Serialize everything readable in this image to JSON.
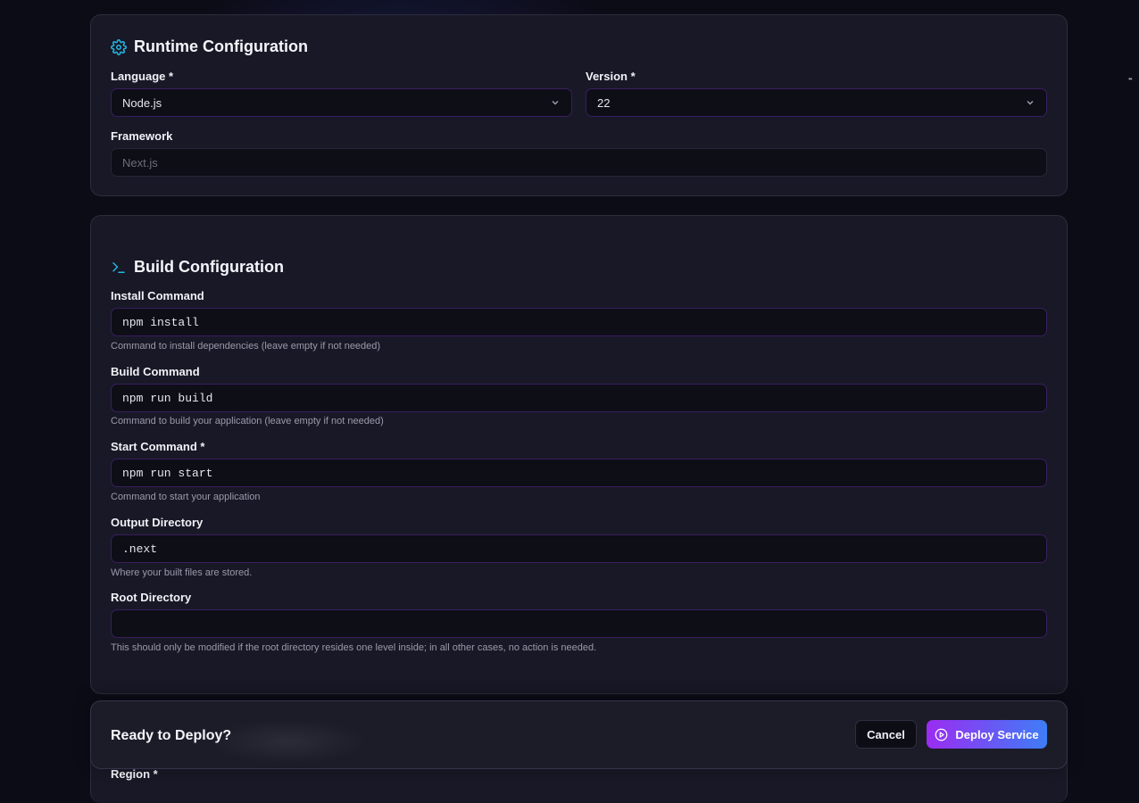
{
  "runtime": {
    "title": "Runtime Configuration",
    "icon": "gear-icon",
    "language_label": "Language *",
    "language_value": "Node.js",
    "version_label": "Version *",
    "version_value": "22",
    "framework_label": "Framework",
    "framework_placeholder": "Next.js"
  },
  "build": {
    "title": "Build Configuration",
    "icon": "terminal-icon",
    "install_label": "Install Command",
    "install_value": "npm install",
    "install_hint": "Command to install dependencies (leave empty if not needed)",
    "build_label": "Build Command",
    "build_value": "npm run build",
    "build_hint": "Command to build your application (leave empty if not needed)",
    "start_label": "Start Command *",
    "start_value": "npm run start",
    "start_hint": "Command to start your application",
    "output_label": "Output Directory",
    "output_value": ".next",
    "output_hint": "Where your built files are stored.",
    "root_label": "Root Directory",
    "root_value": "",
    "root_hint": "This should only be modified if the root directory resides one level inside; in all other cases, no action is needed."
  },
  "deploy": {
    "title": "Ready to Deploy?",
    "cancel_label": "Cancel",
    "deploy_label": "Deploy Service",
    "deploy_icon": "play-circle-icon"
  },
  "region": {
    "label": "Region *"
  },
  "colors": {
    "accent_cyan": "#22b8e6",
    "gradient_start": "#9b2cf2",
    "gradient_end": "#3e7df6",
    "field_border": "#3a1e5e"
  }
}
